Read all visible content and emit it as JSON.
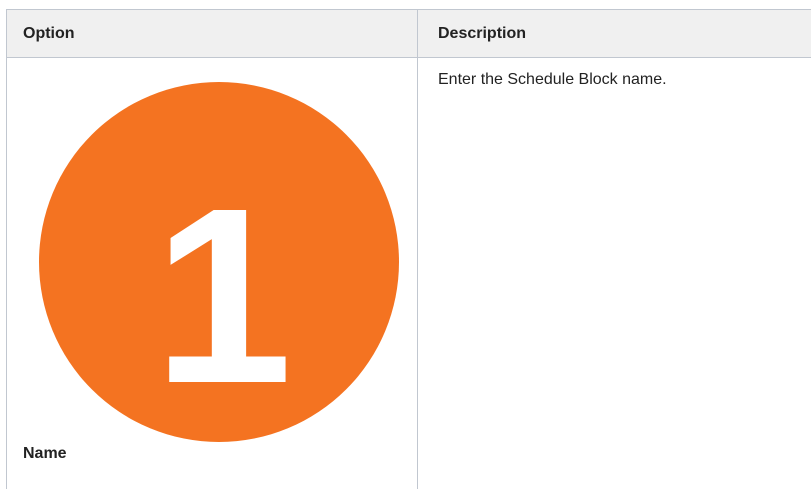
{
  "table": {
    "headers": {
      "option": "Option",
      "description": "Description"
    },
    "rows": [
      {
        "badge_number": "1",
        "badge_color": "#f47321",
        "option_name": "Name",
        "description": "Enter the Schedule Block name."
      }
    ]
  }
}
